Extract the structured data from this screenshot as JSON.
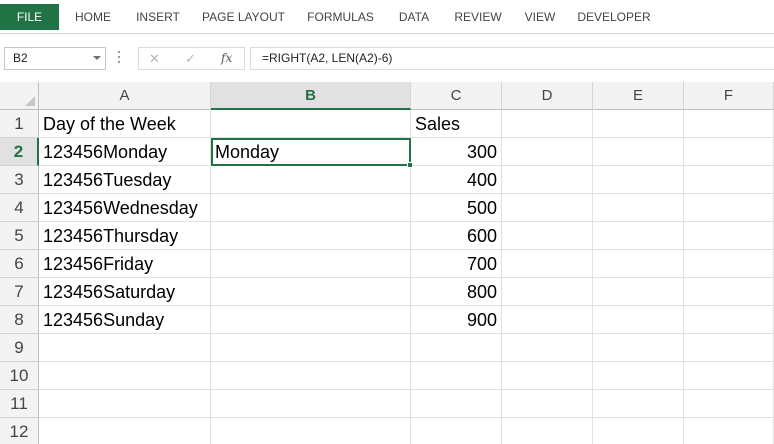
{
  "ribbon": {
    "tabs": [
      "FILE",
      "HOME",
      "INSERT",
      "PAGE LAYOUT",
      "FORMULAS",
      "DATA",
      "REVIEW",
      "VIEW",
      "DEVELOPER"
    ]
  },
  "formula_bar": {
    "name_box": "B2",
    "cancel_icon": "✕",
    "enter_icon": "✓",
    "fx_label": "fx",
    "formula": "=RIGHT(A2, LEN(A2)-6)"
  },
  "sheet": {
    "columns": [
      "A",
      "B",
      "C",
      "D",
      "E",
      "F"
    ],
    "rows": [
      "1",
      "2",
      "3",
      "4",
      "5",
      "6",
      "7",
      "8",
      "9",
      "10",
      "11",
      "12"
    ],
    "selected_cell": "B2",
    "cells": {
      "A1": "Day of the Week",
      "C1": "Sales",
      "A2": "123456Monday",
      "B2": "Monday",
      "C2": "300",
      "A3": "123456Tuesday",
      "C3": "400",
      "A4": "123456Wednesday",
      "C4": "500",
      "A5": "123456Thursday",
      "C5": "600",
      "A6": "123456Friday",
      "C6": "700",
      "A7": "123456Saturday",
      "C7": "800",
      "A8": "123456Sunday",
      "C8": "900"
    }
  },
  "colors": {
    "accent": "#217346"
  }
}
